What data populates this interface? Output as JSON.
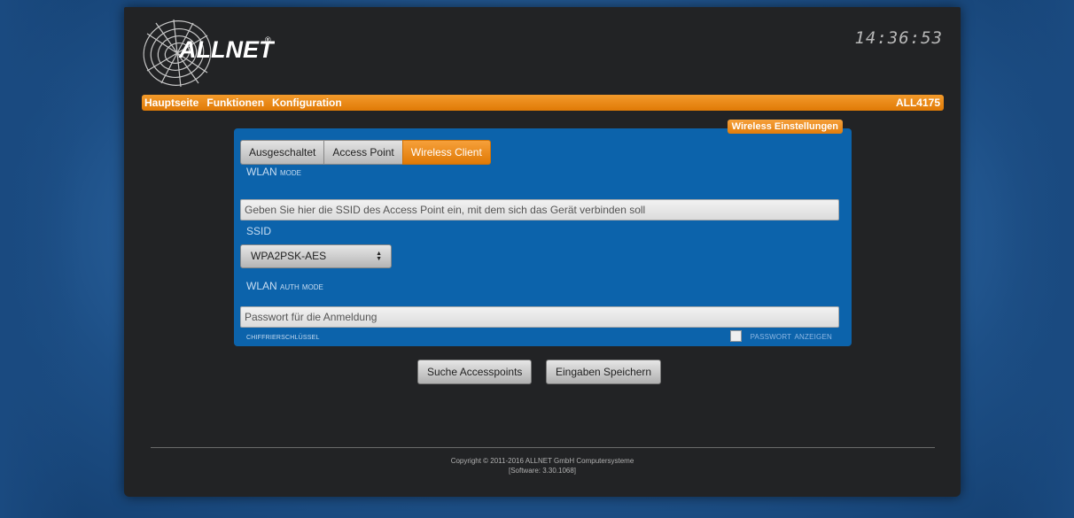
{
  "header": {
    "brand": "ALLNET",
    "trademark": "®",
    "clock": "14:36:53"
  },
  "nav": {
    "items": [
      "Hauptseite",
      "Funktionen",
      "Konfiguration"
    ],
    "device": "ALL4175"
  },
  "panel": {
    "title": "Wireless Einstellungen",
    "wlan_mode": {
      "options": [
        "Ausgeschaltet",
        "Access Point",
        "Wireless Client"
      ],
      "selected": "Wireless Client",
      "label_main": "WLAN",
      "label_sc": "mode"
    },
    "ssid": {
      "placeholder": "Geben Sie hier die SSID des Access Point ein, mit dem sich das Gerät verbinden soll",
      "label": "SSID"
    },
    "auth_mode": {
      "selected": "WPA2PSK-AES",
      "label_main": "WLAN",
      "label_sc": "auth mode"
    },
    "password": {
      "placeholder": "Passwort für die Anmeldung",
      "label": "Chiffrierschlüssel",
      "show_label": "Passwort anzeigen"
    }
  },
  "actions": {
    "search": "Suche Accesspoints",
    "save": "Eingaben Speichern"
  },
  "footer": {
    "copyright": "Copyright © 2011-2016 ALLNET GmbH Computersysteme",
    "software": "[Software: 3.30.1068]"
  },
  "colors": {
    "accent_orange": "#e8850f",
    "panel_blue": "#0c63ab",
    "frame_dark": "#222325"
  }
}
